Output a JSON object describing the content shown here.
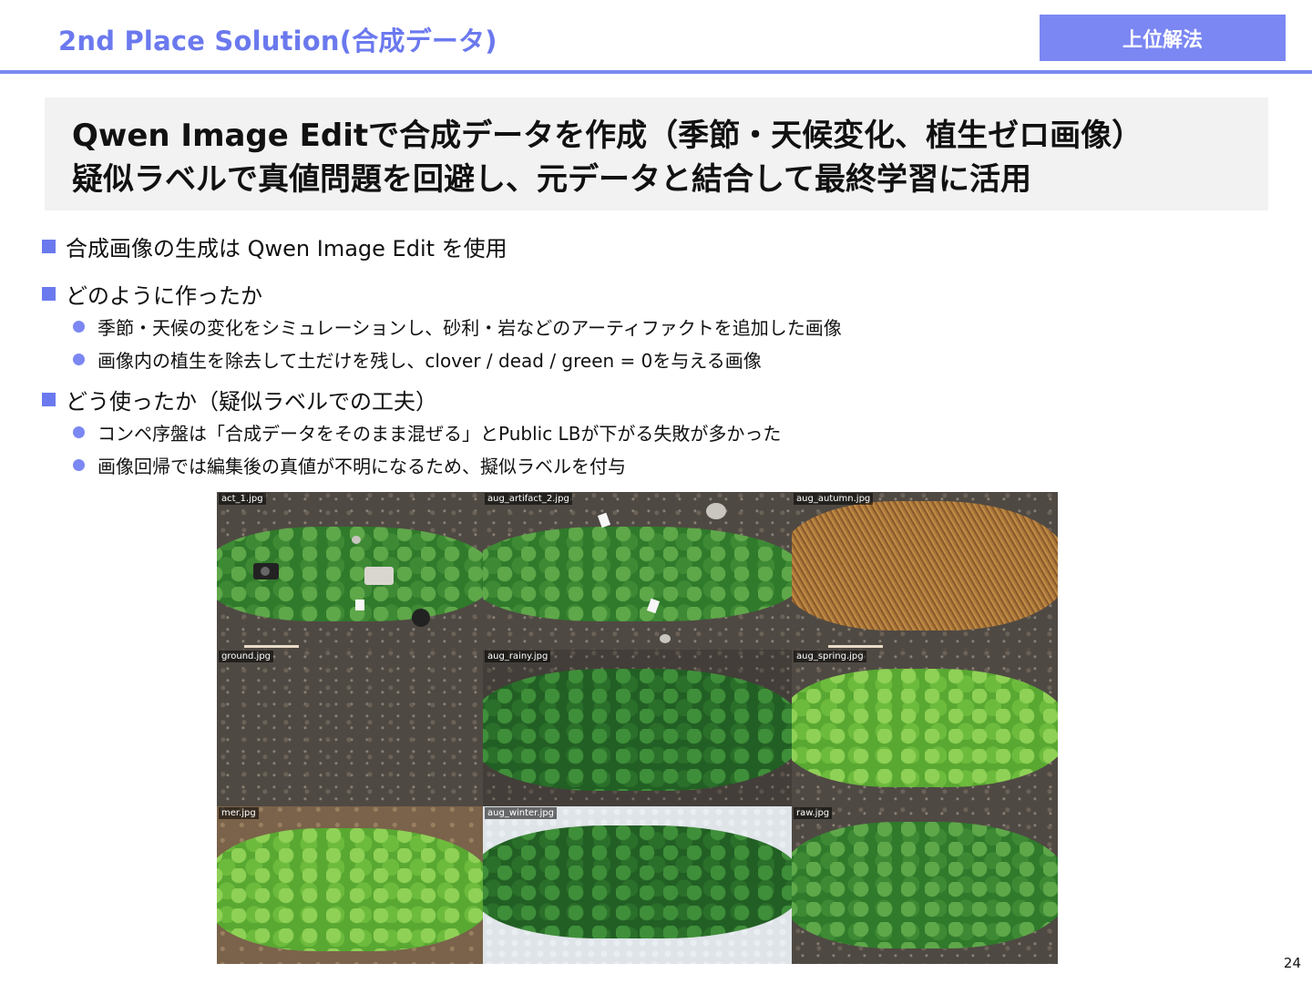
{
  "header": {
    "title": "2nd Place Solution(合成データ)",
    "tag": "上位解法"
  },
  "summary": {
    "line1": "Qwen Image Editで合成データを作成（季節・天候変化、植生ゼロ画像）",
    "line2": "疑似ラベルで真値問題を回避し、元データと結合して最終学習に活用"
  },
  "bullets": {
    "b1": "合成画像の生成は Qwen Image Edit を使用",
    "b2": "どのように作ったか",
    "b2_1": "季節・天候の変化をシミュレーションし、砂利・岩などのアーティファクトを追加した画像",
    "b2_2": "画像内の植生を除去して土だけを残し、clover / dead / green = 0を与える画像",
    "b3": "どう使ったか（疑似ラベルでの工夫）",
    "b3_1": "コンペ序盤は「合成データをそのまま混ぜる」とPublic LBが下がる失敗が多かった",
    "b3_2": "画像回帰では編集後の真値が不明になるため、擬似ラベルを付与"
  },
  "images": [
    {
      "label": "act_1.jpg"
    },
    {
      "label": "aug_artifact_2.jpg"
    },
    {
      "label": "aug_autumn.jpg"
    },
    {
      "label": "ground.jpg"
    },
    {
      "label": "aug_rainy.jpg"
    },
    {
      "label": "aug_spring.jpg"
    },
    {
      "label": "mer.jpg"
    },
    {
      "label": "aug_winter.jpg"
    },
    {
      "label": "raw.jpg"
    }
  ],
  "page_number": "24",
  "colors": {
    "accent": "#7b87f2",
    "title": "#6b79ee",
    "summary_bg": "#f2f2f2"
  }
}
